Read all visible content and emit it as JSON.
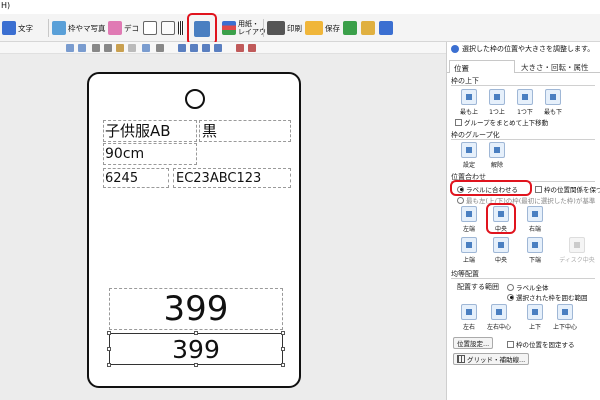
{
  "title_fragment": "H)",
  "toolbar": {
    "items": [
      {
        "label": "文字",
        "icon": "text-icon"
      },
      {
        "label": "枠やマ写真",
        "icon": "image-frame-icon"
      },
      {
        "label": "デコ",
        "icon": "decoration-icon"
      },
      {
        "label": "",
        "icon": "table-icon"
      },
      {
        "label": "",
        "icon": "number-icon"
      },
      {
        "label": "",
        "icon": "barcode-icon"
      },
      {
        "label": "",
        "icon": "position-adjust-icon"
      },
      {
        "label": "用紙・",
        "label2": "レイアウト",
        "icon": "paper-layout-icon"
      },
      {
        "label": "印刷",
        "icon": "print-icon"
      },
      {
        "label": "保存",
        "icon": "save-folder-icon"
      }
    ]
  },
  "label": {
    "fields": [
      {
        "name": "product-name-field",
        "text": "子供服AB"
      },
      {
        "name": "color-field",
        "text": "黒"
      },
      {
        "name": "size-field",
        "text": "90cm"
      },
      {
        "name": "code-field",
        "text": "6245"
      },
      {
        "name": "sku-field",
        "text": "EC23ABC123"
      },
      {
        "name": "price-large-field",
        "text": "399"
      },
      {
        "name": "price-selected-field",
        "text": "399"
      }
    ]
  },
  "panel": {
    "hint": "選択した枠の位置や大きさを調整します。",
    "tabs": {
      "active": "位置",
      "inactive": "大きさ・回転・属性"
    },
    "order": {
      "title": "枠の上下",
      "buttons": [
        "最も上",
        "1つ上",
        "1つ下",
        "最も下"
      ],
      "group_move": "グループをまとめて上下移動"
    },
    "grouping": {
      "title": "枠のグループ化",
      "buttons": [
        "設定",
        "解除"
      ]
    },
    "align": {
      "title": "位置合わせ",
      "radio_label": "ラベルに合わせる",
      "check_keep": "枠の位置関係を保つ",
      "radio_selected": "最も左(上/下)の枠(最初に選択した枠)が基準",
      "row1": [
        "左端",
        "中央",
        "右端"
      ],
      "row2": [
        "上端",
        "中央",
        "下端",
        "ディスク中央"
      ]
    },
    "distribute": {
      "title": "均等配置",
      "range_label": "配置する範囲",
      "radio_all": "ラベル全体",
      "radio_selected": "選択された枠を囲む範囲",
      "buttons": [
        "左右",
        "左右中心",
        "上下",
        "上下中心"
      ]
    },
    "position_settings": "位置設定...",
    "lock_position": "枠の位置を固定する",
    "grid_button": "グリッド・補助線..."
  },
  "colors": {
    "highlight": "#e0141e",
    "accent": "#4a7fc1",
    "canvas_bg": "#ececec"
  }
}
